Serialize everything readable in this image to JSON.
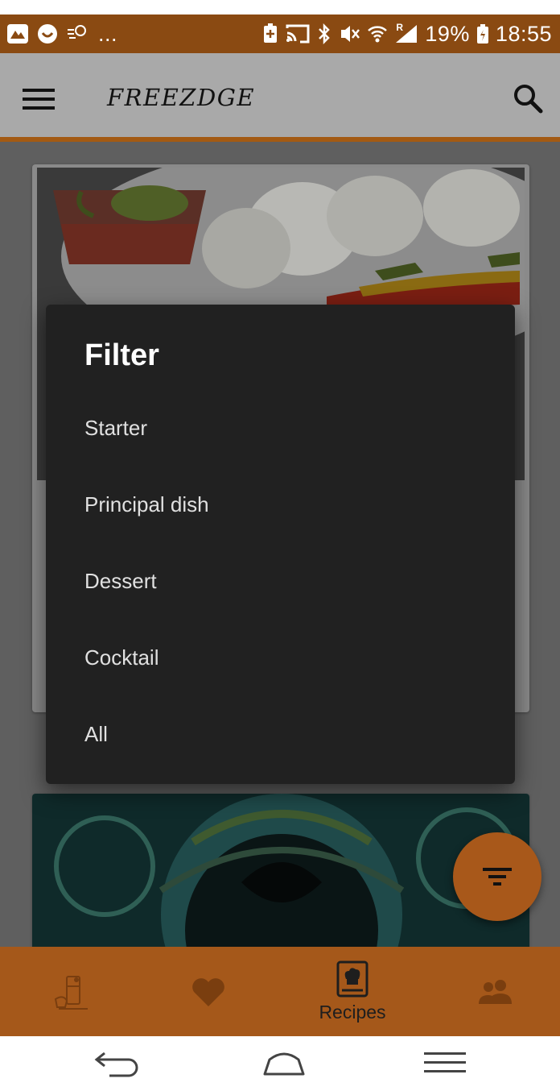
{
  "status_bar": {
    "left_more": "...",
    "battery_percent": "19%",
    "time": "18:55",
    "roaming_label": "R"
  },
  "app_bar": {
    "title": "FREEZDGE",
    "menu_icon": "hamburger-menu-icon",
    "search_icon": "search-icon"
  },
  "dialog": {
    "title": "Filter",
    "options": [
      "Starter",
      "Principal dish",
      "Dessert",
      "Cocktail",
      "All"
    ]
  },
  "fab": {
    "icon": "filter-list-icon"
  },
  "bottom_nav": {
    "items": [
      {
        "icon": "fridge-icon",
        "label": ""
      },
      {
        "icon": "heart-icon",
        "label": ""
      },
      {
        "icon": "recipe-book-icon",
        "label": "Recipes",
        "selected": true
      },
      {
        "icon": "people-icon",
        "label": ""
      }
    ]
  },
  "system_nav": {
    "back": "back-icon",
    "home": "home-icon",
    "menu": "recents-icon"
  },
  "colors": {
    "status_bar": "#8a4a12",
    "app_bar": "#a9a9a9",
    "accent": "#a5581a",
    "dialog_bg": "#212121",
    "dialog_text": "#e0e0e0"
  }
}
